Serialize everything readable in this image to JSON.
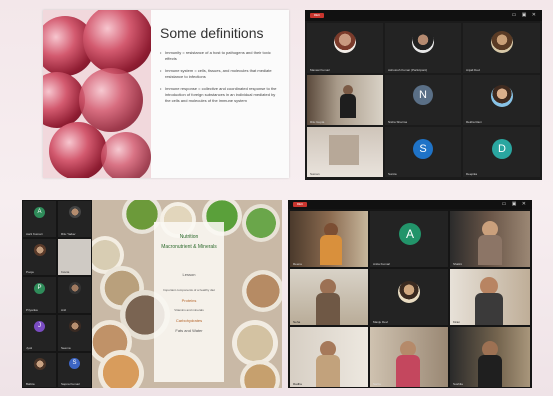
{
  "slide": {
    "title": "Some definitions",
    "bullets": [
      "Immunity = resistance of a host to pathogens and their toxic effects",
      "Immune system = cells, tissues, and molecules that mediate resistance to infections",
      "Immune response = collective and coordinated response to the introduction of foreign substances in an individual mediated by the cells and molecules of the immune system"
    ]
  },
  "gallery_top": {
    "rec_label": "REC",
    "tiles": [
      {
        "name": "Manasi Kumari",
        "avatar": "photo"
      },
      {
        "name": "Ashutosh Kumar (Participant)",
        "avatar": "photo"
      },
      {
        "name": "Anjali Devi",
        "avatar": "photo"
      },
      {
        "name": "Ritu Gupta",
        "avatar": "video"
      },
      {
        "name": "Nisha Sharma",
        "avatar": "letter",
        "letter": "N",
        "color": "#5a6f86"
      },
      {
        "name": "Rekha Rani",
        "avatar": "photo"
      },
      {
        "name": "Suman",
        "avatar": "video"
      },
      {
        "name": "Sunita",
        "avatar": "letter",
        "letter": "S",
        "color": "#1f73c7"
      },
      {
        "name": "Deepika",
        "avatar": "letter",
        "letter": "D",
        "color": "#2aa6a0"
      }
    ]
  },
  "gallery_left": {
    "tiles": [
      {
        "name": "Aarti Kumari",
        "letter": "A",
        "color": "#2f8c5a"
      },
      {
        "name": "Ritu Yadav",
        "letter": "",
        "color": ""
      },
      {
        "name": "Pooja",
        "letter": "",
        "color": ""
      },
      {
        "name": "Kavita",
        "letter": "",
        "color": ""
      },
      {
        "name": "Priyanka",
        "letter": "P",
        "color": "#2f8c5a"
      },
      {
        "name": "Anil",
        "letter": "",
        "color": ""
      },
      {
        "name": "Jyoti",
        "letter": "J",
        "color": "#7a4cc2"
      },
      {
        "name": "Seema",
        "letter": "",
        "color": ""
      },
      {
        "name": "Babita",
        "letter": "",
        "color": ""
      },
      {
        "name": "Sapna Kumari",
        "letter": "S",
        "color": "#3c65c4"
      }
    ]
  },
  "nutrition_slide": {
    "heading": "Nutrition",
    "subheading": "Macronutrient & Minerals",
    "label": "Lesson",
    "lines": [
      "Important components of a healthy diet",
      "Proteins",
      "Vitamins and minerals",
      "Carbohydrates",
      "Fats and Water"
    ]
  },
  "gallery_bottom": {
    "tiles": [
      {
        "name": "Reena",
        "avatar": "video"
      },
      {
        "name": "Anita Kumari",
        "avatar": "letter",
        "letter": "A",
        "color": "#22946a"
      },
      {
        "name": "Shalini",
        "avatar": "video"
      },
      {
        "name": "Neha",
        "avatar": "video"
      },
      {
        "name": "Manju Devi",
        "avatar": "photo"
      },
      {
        "name": "Kiran",
        "avatar": "video"
      },
      {
        "name": "Radha",
        "avatar": "video"
      },
      {
        "name": "Sarita",
        "avatar": "video"
      },
      {
        "name": "Sushila",
        "avatar": "video"
      }
    ]
  }
}
